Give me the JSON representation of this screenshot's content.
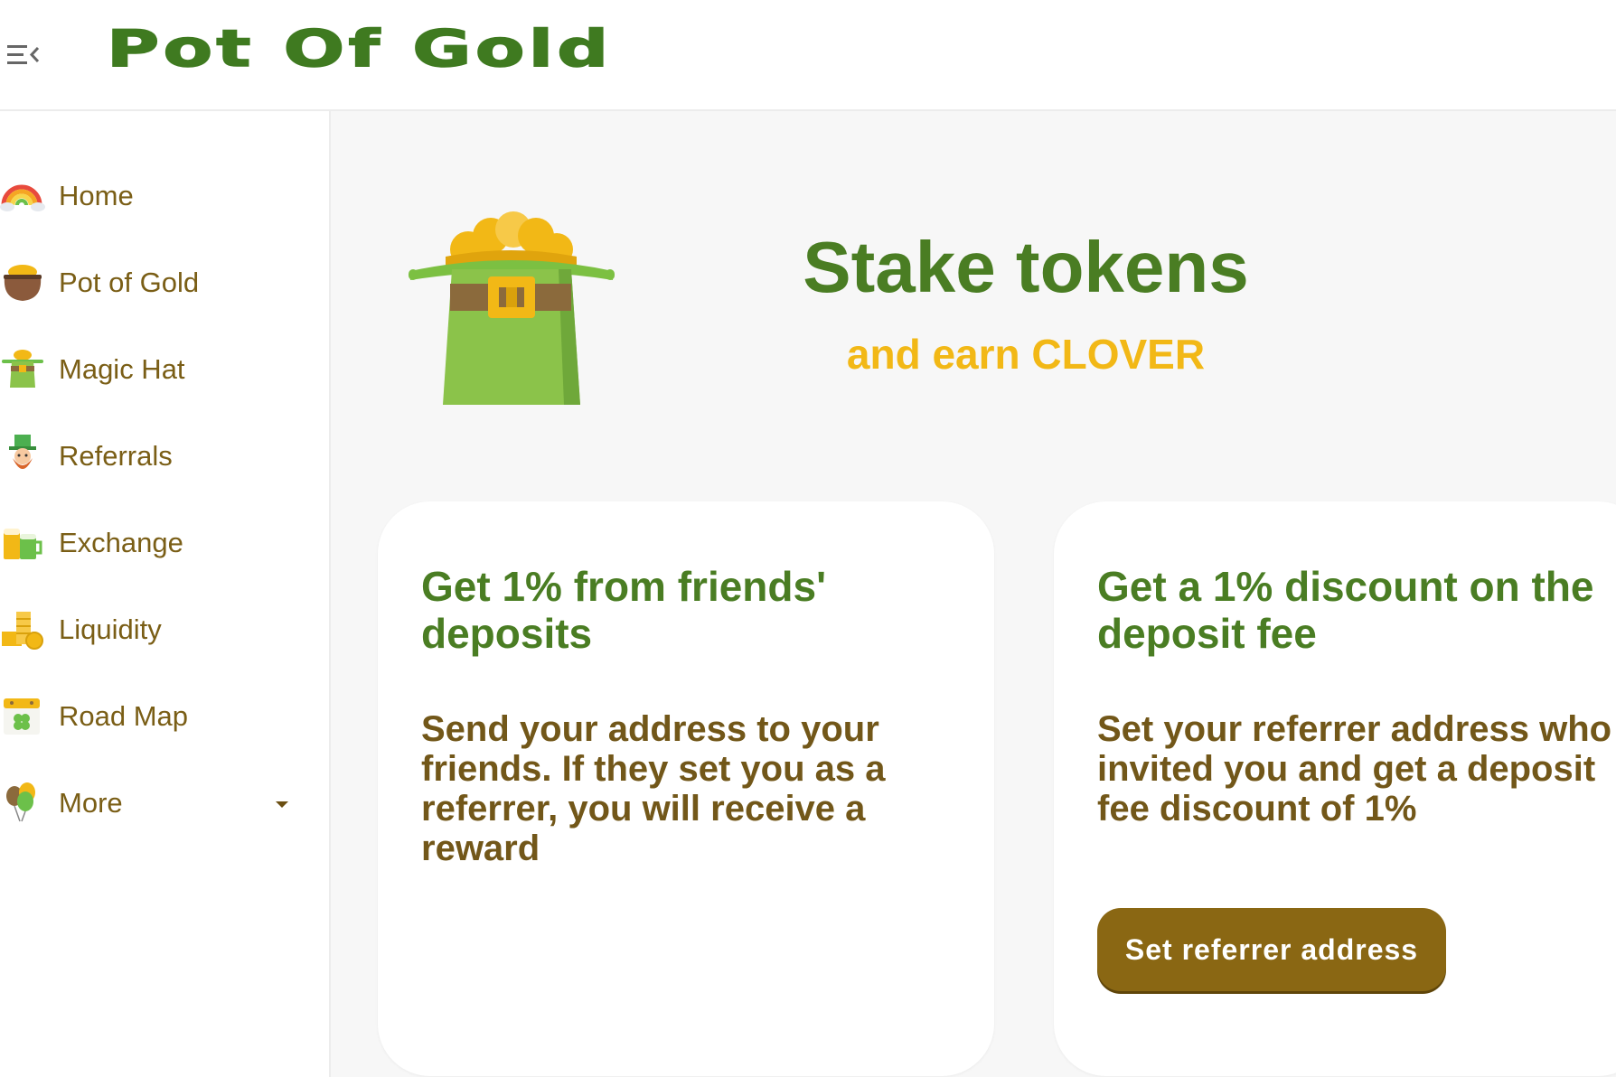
{
  "header": {
    "logo_text": "Pot Of Gold",
    "menu_icon": "menu-collapse-icon"
  },
  "sidebar": {
    "items": [
      {
        "label": "Home",
        "icon": "rainbow-icon"
      },
      {
        "label": "Pot of Gold",
        "icon": "pot-of-gold-icon"
      },
      {
        "label": "Magic Hat",
        "icon": "magic-hat-icon"
      },
      {
        "label": "Referrals",
        "icon": "leprechaun-icon"
      },
      {
        "label": "Exchange",
        "icon": "beer-mugs-icon"
      },
      {
        "label": "Liquidity",
        "icon": "coins-icon"
      },
      {
        "label": "Road Map",
        "icon": "calendar-clover-icon"
      },
      {
        "label": "More",
        "icon": "balloons-icon",
        "expand_icon": "caret-down-icon"
      }
    ]
  },
  "hero": {
    "title": "Stake tokens",
    "subtitle": "and earn CLOVER",
    "image": "leprechaun-hat-gold-icon"
  },
  "cards": [
    {
      "title": "Get 1% from friends' deposits",
      "text": "Send your address to your friends. If they set you as a referrer, you will receive a reward"
    },
    {
      "title": "Get a 1% discount on the deposit fee",
      "text": "Set your referrer address who invited you and get a deposit fee discount of 1%",
      "button_label": "Set referrer address"
    }
  ],
  "colors": {
    "brand_green": "#4a7d23",
    "text_brown": "#725719",
    "accent_gold": "#f2b816",
    "button_brown": "#8a6713",
    "background": "#f7f7f7"
  }
}
